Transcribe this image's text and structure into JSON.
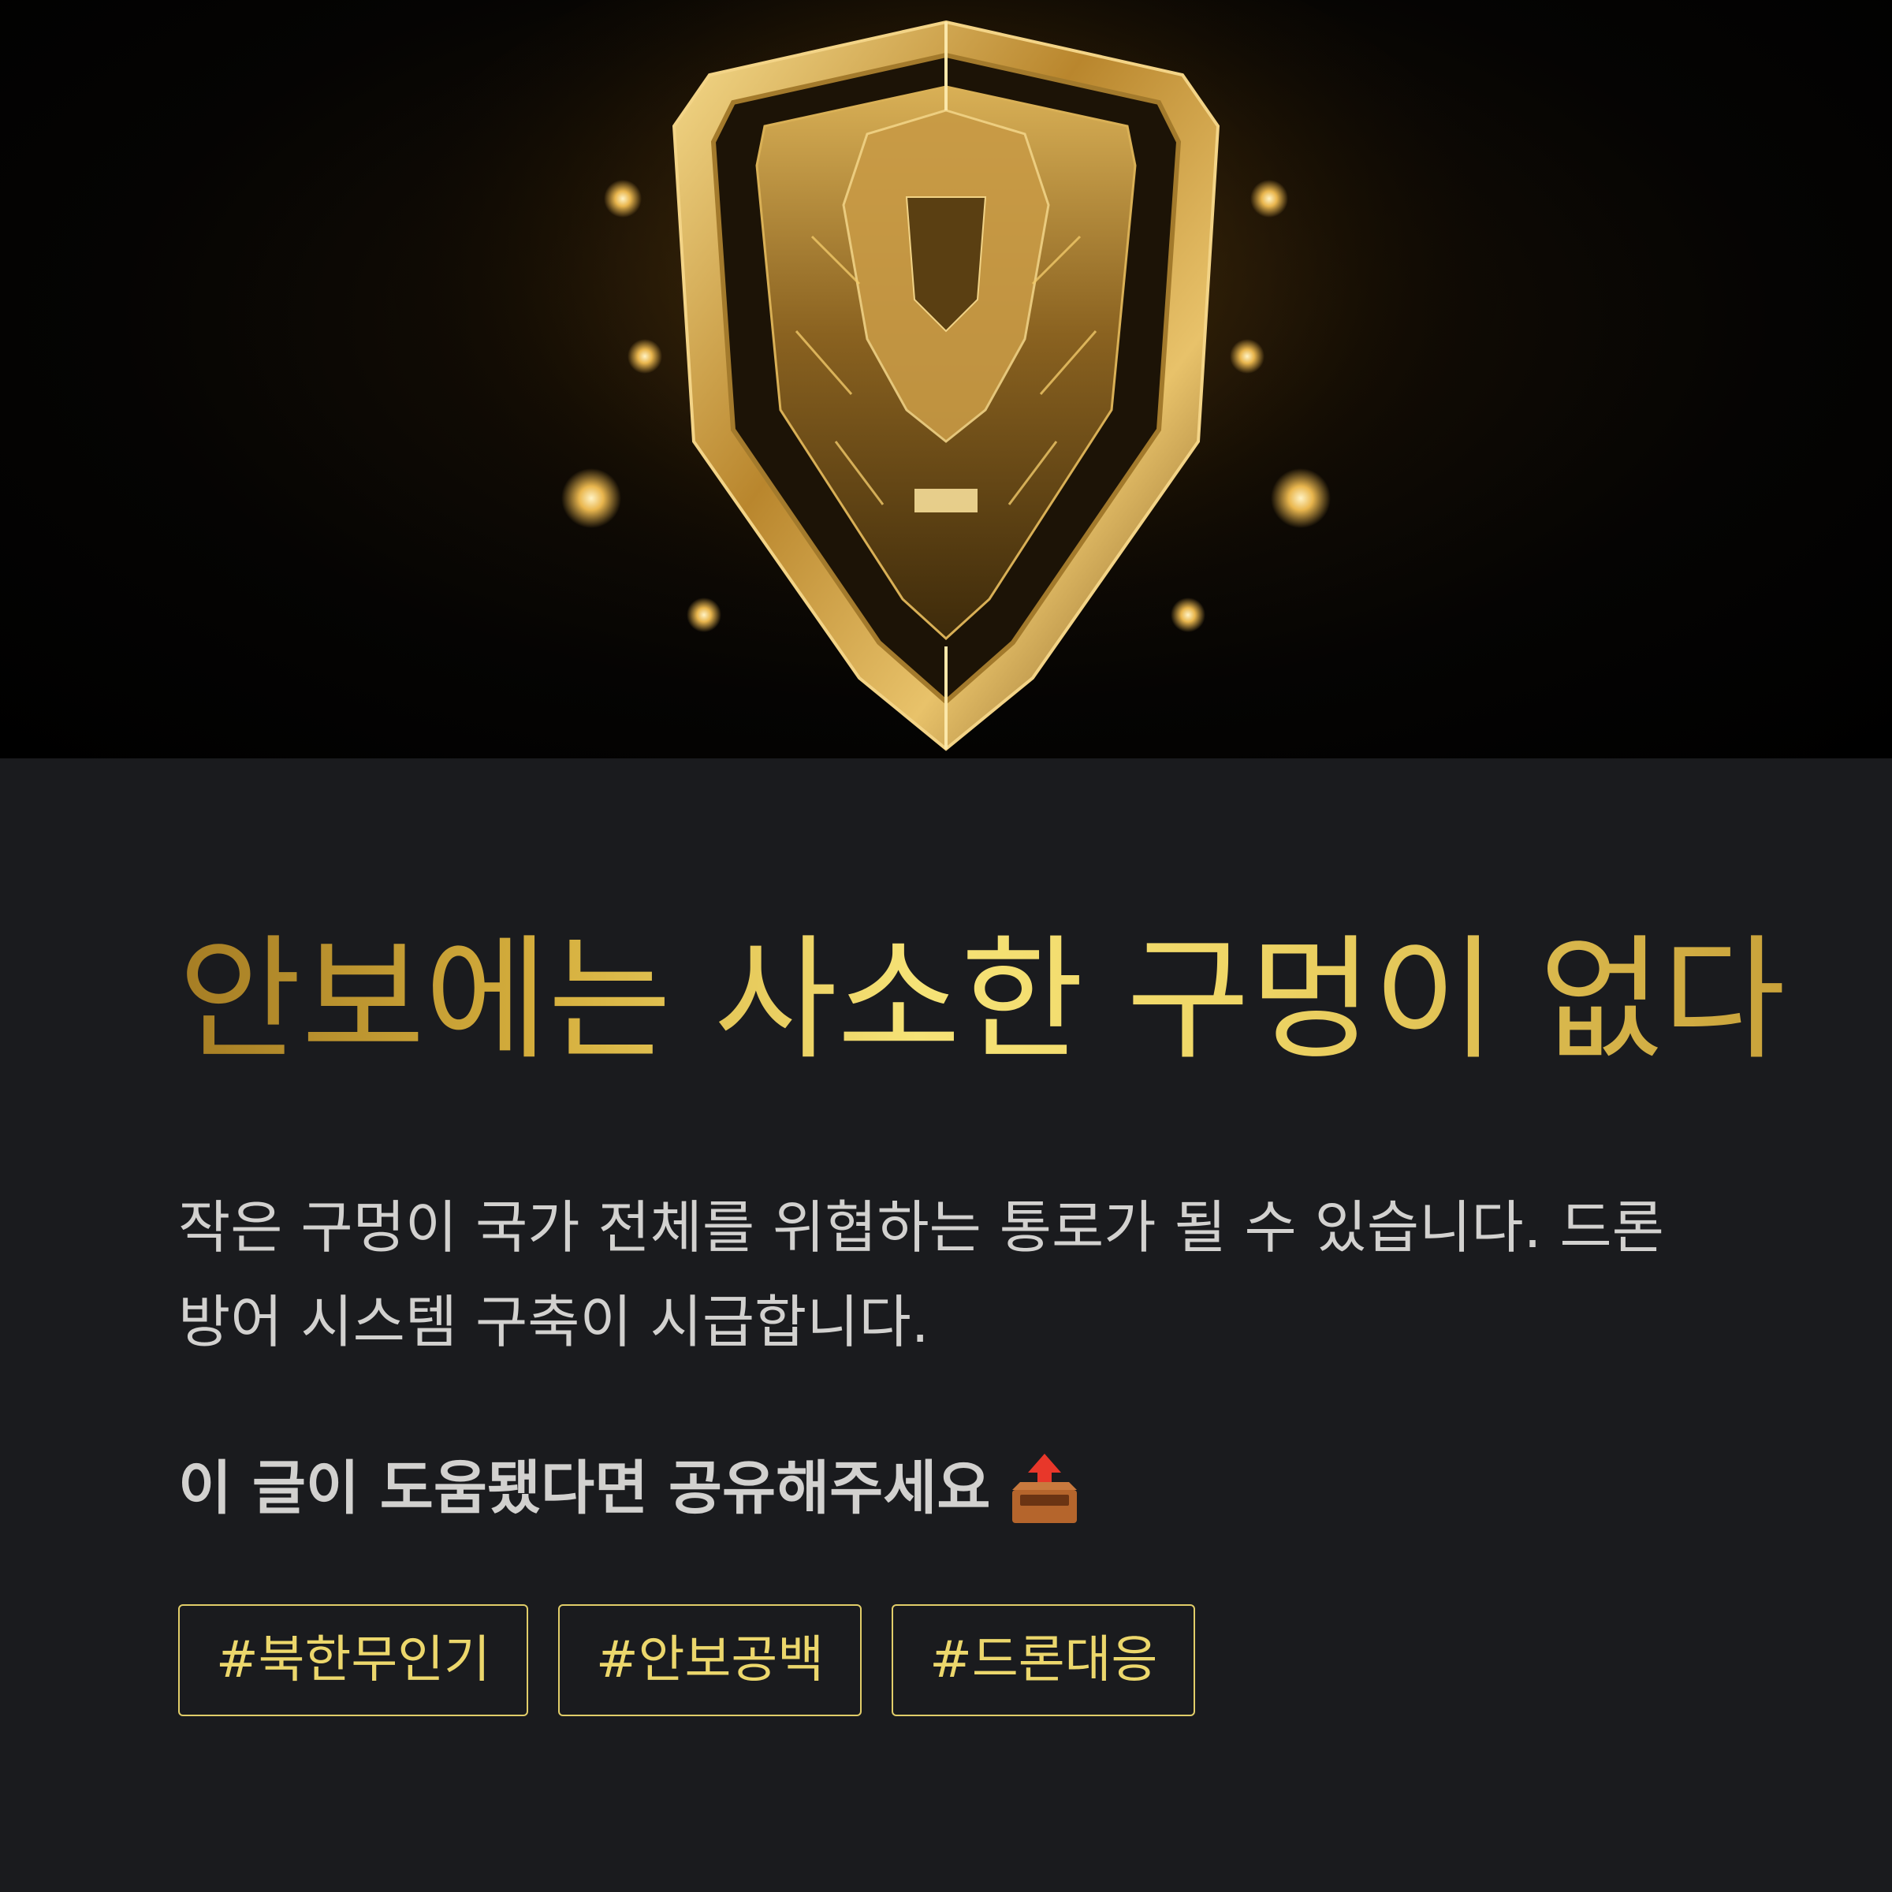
{
  "hero": {
    "image": "golden-tech-shield-with-orbiting-drones"
  },
  "headline": "안보에는 사소한 구멍이 없다",
  "body_text": "작은 구멍이 국가 전체를 위협하는 통로가 될 수 있습니다. 드론 방어 시스템 구축이 시급합니다.",
  "cta": {
    "text": "이 글이 도움됐다면 공유해주세요",
    "icon": "outbox-tray-icon"
  },
  "tags": [
    "#북한무인기",
    "#안보공백",
    "#드론대응"
  ],
  "colors": {
    "background": "#1a1b1e",
    "gold": "#ecd76c",
    "body_text": "#d2d1cf"
  }
}
